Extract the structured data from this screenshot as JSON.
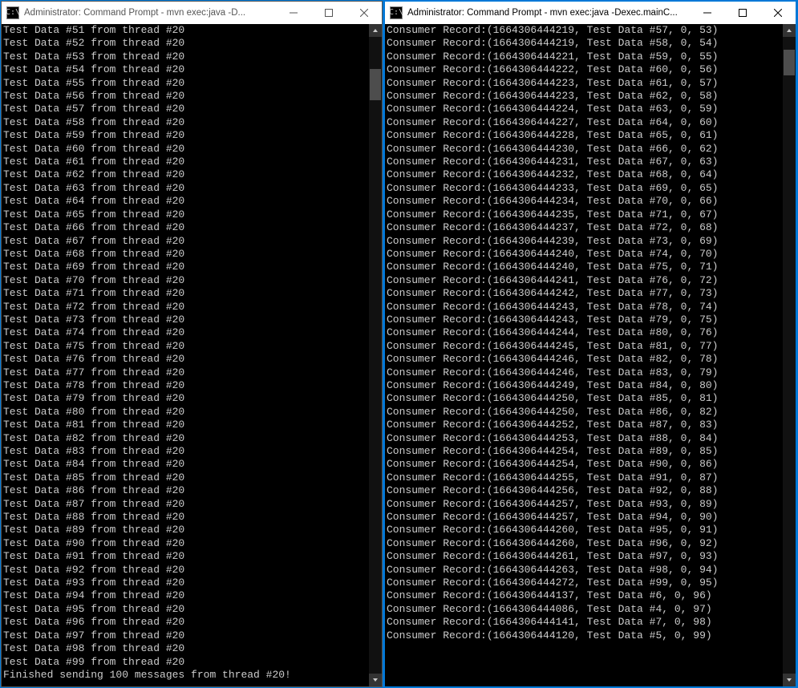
{
  "left_window": {
    "title": "Administrator: Command Prompt - mvn  exec:java -D...",
    "icon_glyph": "C:\\",
    "lines": [
      "Test Data #51 from thread #20",
      "Test Data #52 from thread #20",
      "Test Data #53 from thread #20",
      "Test Data #54 from thread #20",
      "Test Data #55 from thread #20",
      "Test Data #56 from thread #20",
      "Test Data #57 from thread #20",
      "Test Data #58 from thread #20",
      "Test Data #59 from thread #20",
      "Test Data #60 from thread #20",
      "Test Data #61 from thread #20",
      "Test Data #62 from thread #20",
      "Test Data #63 from thread #20",
      "Test Data #64 from thread #20",
      "Test Data #65 from thread #20",
      "Test Data #66 from thread #20",
      "Test Data #67 from thread #20",
      "Test Data #68 from thread #20",
      "Test Data #69 from thread #20",
      "Test Data #70 from thread #20",
      "Test Data #71 from thread #20",
      "Test Data #72 from thread #20",
      "Test Data #73 from thread #20",
      "Test Data #74 from thread #20",
      "Test Data #75 from thread #20",
      "Test Data #76 from thread #20",
      "Test Data #77 from thread #20",
      "Test Data #78 from thread #20",
      "Test Data #79 from thread #20",
      "Test Data #80 from thread #20",
      "Test Data #81 from thread #20",
      "Test Data #82 from thread #20",
      "Test Data #83 from thread #20",
      "Test Data #84 from thread #20",
      "Test Data #85 from thread #20",
      "Test Data #86 from thread #20",
      "Test Data #87 from thread #20",
      "Test Data #88 from thread #20",
      "Test Data #89 from thread #20",
      "Test Data #90 from thread #20",
      "Test Data #91 from thread #20",
      "Test Data #92 from thread #20",
      "Test Data #93 from thread #20",
      "Test Data #94 from thread #20",
      "Test Data #95 from thread #20",
      "Test Data #96 from thread #20",
      "Test Data #97 from thread #20",
      "Test Data #98 from thread #20",
      "Test Data #99 from thread #20",
      "Finished sending 100 messages from thread #20!"
    ],
    "scroll_thumb": {
      "top_pct": 5,
      "height_pct": 5
    }
  },
  "right_window": {
    "title": "Administrator: Command Prompt - mvn  exec:java -Dexec.mainC...",
    "icon_glyph": "C:\\",
    "lines": [
      "Consumer Record:(1664306444219, Test Data #57, 0, 53)",
      "Consumer Record:(1664306444219, Test Data #58, 0, 54)",
      "Consumer Record:(1664306444221, Test Data #59, 0, 55)",
      "Consumer Record:(1664306444222, Test Data #60, 0, 56)",
      "Consumer Record:(1664306444223, Test Data #61, 0, 57)",
      "Consumer Record:(1664306444223, Test Data #62, 0, 58)",
      "Consumer Record:(1664306444224, Test Data #63, 0, 59)",
      "Consumer Record:(1664306444227, Test Data #64, 0, 60)",
      "Consumer Record:(1664306444228, Test Data #65, 0, 61)",
      "Consumer Record:(1664306444230, Test Data #66, 0, 62)",
      "Consumer Record:(1664306444231, Test Data #67, 0, 63)",
      "Consumer Record:(1664306444232, Test Data #68, 0, 64)",
      "Consumer Record:(1664306444233, Test Data #69, 0, 65)",
      "Consumer Record:(1664306444234, Test Data #70, 0, 66)",
      "Consumer Record:(1664306444235, Test Data #71, 0, 67)",
      "Consumer Record:(1664306444237, Test Data #72, 0, 68)",
      "Consumer Record:(1664306444239, Test Data #73, 0, 69)",
      "Consumer Record:(1664306444240, Test Data #74, 0, 70)",
      "Consumer Record:(1664306444240, Test Data #75, 0, 71)",
      "Consumer Record:(1664306444241, Test Data #76, 0, 72)",
      "Consumer Record:(1664306444242, Test Data #77, 0, 73)",
      "Consumer Record:(1664306444243, Test Data #78, 0, 74)",
      "Consumer Record:(1664306444243, Test Data #79, 0, 75)",
      "Consumer Record:(1664306444244, Test Data #80, 0, 76)",
      "Consumer Record:(1664306444245, Test Data #81, 0, 77)",
      "Consumer Record:(1664306444246, Test Data #82, 0, 78)",
      "Consumer Record:(1664306444246, Test Data #83, 0, 79)",
      "Consumer Record:(1664306444249, Test Data #84, 0, 80)",
      "Consumer Record:(1664306444250, Test Data #85, 0, 81)",
      "Consumer Record:(1664306444250, Test Data #86, 0, 82)",
      "Consumer Record:(1664306444252, Test Data #87, 0, 83)",
      "Consumer Record:(1664306444253, Test Data #88, 0, 84)",
      "Consumer Record:(1664306444254, Test Data #89, 0, 85)",
      "Consumer Record:(1664306444254, Test Data #90, 0, 86)",
      "Consumer Record:(1664306444255, Test Data #91, 0, 87)",
      "Consumer Record:(1664306444256, Test Data #92, 0, 88)",
      "Consumer Record:(1664306444257, Test Data #93, 0, 89)",
      "Consumer Record:(1664306444257, Test Data #94, 0, 90)",
      "Consumer Record:(1664306444260, Test Data #95, 0, 91)",
      "Consumer Record:(1664306444260, Test Data #96, 0, 92)",
      "Consumer Record:(1664306444261, Test Data #97, 0, 93)",
      "Consumer Record:(1664306444263, Test Data #98, 0, 94)",
      "Consumer Record:(1664306444272, Test Data #99, 0, 95)",
      "Consumer Record:(1664306444137, Test Data #6, 0, 96)",
      "Consumer Record:(1664306444086, Test Data #4, 0, 97)",
      "Consumer Record:(1664306444141, Test Data #7, 0, 98)",
      "Consumer Record:(1664306444120, Test Data #5, 0, 99)"
    ],
    "scroll_thumb": {
      "top_pct": 2,
      "height_pct": 4
    }
  }
}
